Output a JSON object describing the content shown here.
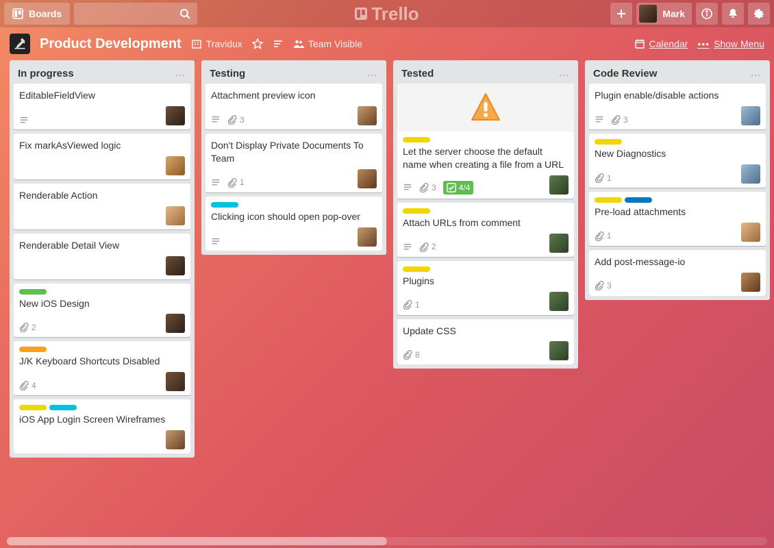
{
  "header": {
    "boards_label": "Boards",
    "logo_text": "Trello",
    "user_name": "Mark"
  },
  "board": {
    "title": "Product Development",
    "team": "Travidux",
    "visibility": "Team Visible",
    "calendar_label": "Calendar",
    "show_menu_label": "Show Menu"
  },
  "lists": [
    {
      "title": "In progress",
      "cards": [
        {
          "title": "EditableFieldView",
          "labels": [],
          "desc": true,
          "members": [
            "av1"
          ]
        },
        {
          "title": "Fix markAsViewed logic",
          "labels": [],
          "members": [
            "av2"
          ]
        },
        {
          "title": "Renderable Action",
          "labels": [],
          "members": [
            "av3"
          ]
        },
        {
          "title": "Renderable Detail View",
          "labels": [],
          "members": [
            "av1"
          ]
        },
        {
          "title": "New iOS Design",
          "labels": [
            "l-green"
          ],
          "attach": "2",
          "members": [
            "av1"
          ]
        },
        {
          "title": "J/K Keyboard Shortcuts Disabled",
          "labels": [
            "l-orange"
          ],
          "attach": "4",
          "members": [
            "av4"
          ]
        },
        {
          "title": "iOS App Login Screen Wireframes",
          "labels": [
            "l-yellow",
            "l-cyan"
          ],
          "members": [
            "av5"
          ]
        }
      ]
    },
    {
      "title": "Testing",
      "cards": [
        {
          "title": "Attachment preview icon",
          "labels": [],
          "desc": true,
          "attach": "3",
          "members": [
            "av5"
          ]
        },
        {
          "title": "Don't Display Private Documents To Team",
          "labels": [],
          "desc": true,
          "attach": "1",
          "members": [
            "av8"
          ]
        },
        {
          "title": "Clicking icon should open pop-over",
          "labels": [
            "l-cyan"
          ],
          "desc": true,
          "members": [
            "av5"
          ]
        }
      ]
    },
    {
      "title": "Tested",
      "cards": [
        {
          "title": "Let the server choose the default name when creating a file from a URL",
          "labels": [
            "l-yellow"
          ],
          "cover": "warn",
          "desc": true,
          "attach": "3",
          "check": "4/4",
          "members": [
            "av6"
          ]
        },
        {
          "title": "Attach URLs from comment",
          "labels": [
            "l-yellow"
          ],
          "desc": true,
          "attach": "2",
          "members": [
            "av6"
          ]
        },
        {
          "title": "Plugins",
          "labels": [
            "l-yellow"
          ],
          "attach": "1",
          "members": [
            "av6"
          ]
        },
        {
          "title": "Update CSS",
          "labels": [],
          "attach": "8",
          "members": [
            "av6"
          ]
        }
      ]
    },
    {
      "title": "Code Review",
      "cards": [
        {
          "title": "Plugin enable/disable actions",
          "labels": [],
          "desc": true,
          "attach": "3",
          "members": [
            "av7"
          ]
        },
        {
          "title": "New Diagnostics",
          "labels": [
            "l-yellow"
          ],
          "attach": "1",
          "members": [
            "av7"
          ]
        },
        {
          "title": "Pre-load attachments",
          "labels": [
            "l-yellow",
            "l-blue"
          ],
          "attach": "1",
          "members": [
            "av3"
          ]
        },
        {
          "title": "Add post-message-io",
          "labels": [],
          "attach": "3",
          "members": [
            "av8"
          ]
        }
      ]
    }
  ]
}
